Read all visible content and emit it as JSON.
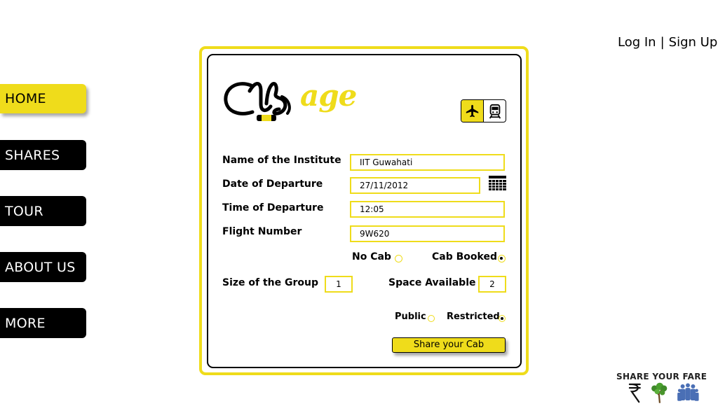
{
  "nav": {
    "items": [
      {
        "label": "HOME",
        "active": true
      },
      {
        "label": "SHARES",
        "active": false
      },
      {
        "label": "TOUR",
        "active": false
      },
      {
        "label": "ABOUT US",
        "active": false
      },
      {
        "label": "MORE",
        "active": false
      }
    ]
  },
  "auth": {
    "login": "Log In",
    "separator": "|",
    "signup": "Sign Up"
  },
  "logo": {
    "suffix": "age"
  },
  "mode": {
    "options": [
      "airplane-icon",
      "train-icon"
    ],
    "selected": "airplane"
  },
  "form": {
    "institute_label": "Name of the Institute",
    "institute_value": "IIT Guwahati",
    "date_label": "Date of Departure",
    "date_value": "27/11/2012",
    "time_label": "Time of Departure",
    "time_value": "12:05",
    "flight_label": "Flight Number",
    "flight_value": "9W620",
    "no_cab_label": "No Cab",
    "cab_booked_label": "Cab Booked",
    "cab_selected": "Cab Booked",
    "group_label": "Size of the Group",
    "group_value": "1",
    "space_label": "Space Available",
    "space_value": "2",
    "public_label": "Public",
    "restricted_label": "Restricted",
    "visibility_selected": "Restricted",
    "submit_label": "Share your Cab"
  },
  "footer": {
    "title": "SHARE YOUR FARE"
  },
  "colors": {
    "accent": "#efdc1b",
    "dark": "#000000",
    "footer_green": "#4a8a2a",
    "footer_blue": "#4a6fb5"
  }
}
